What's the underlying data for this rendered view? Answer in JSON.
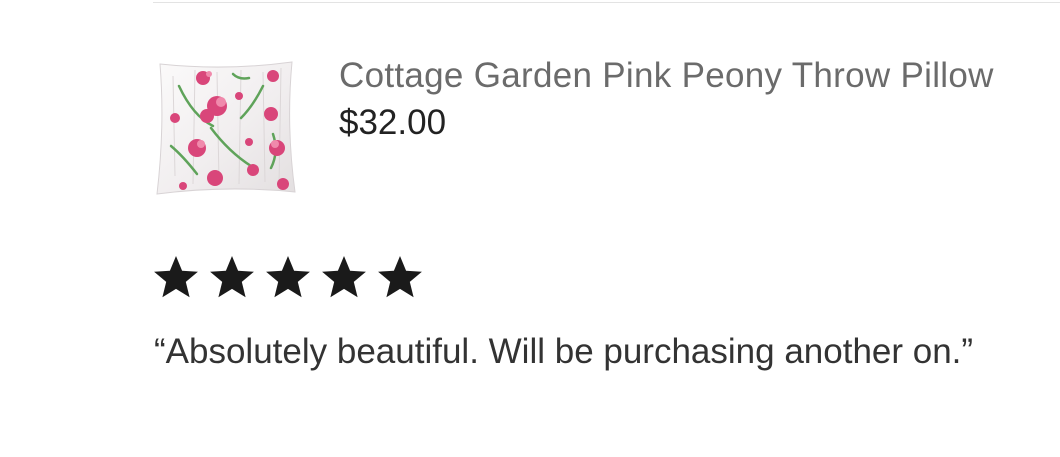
{
  "product": {
    "title": "Cottage Garden Pink Peony Throw Pillow",
    "price": "$32.00",
    "image_icon": "peony-pillow-thumbnail"
  },
  "review": {
    "rating": 5,
    "rating_max": 5,
    "star_icon": "star-icon",
    "text": "“Absolutely beautiful. Will be purchasing another on.”"
  },
  "colors": {
    "title_gray": "#6b6b6b",
    "price_dark": "#222222",
    "star_black": "#1a1a1a",
    "review_text": "#333333",
    "peony_pink": "#d9467a"
  }
}
